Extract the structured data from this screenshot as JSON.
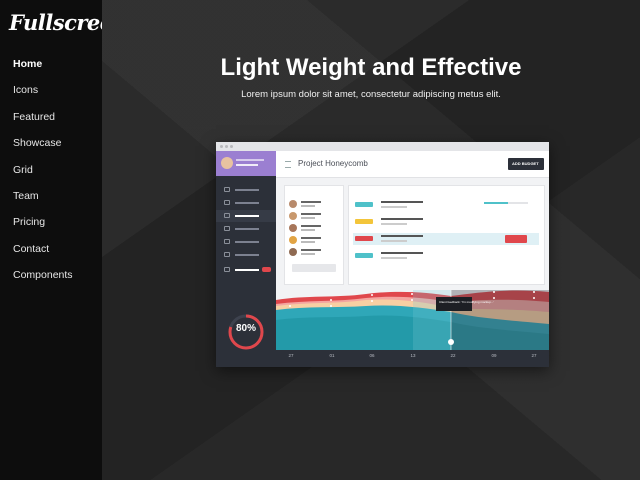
{
  "sidebar": {
    "logo": "Fullscreen",
    "items": [
      {
        "label": "Home"
      },
      {
        "label": "Icons"
      },
      {
        "label": "Featured"
      },
      {
        "label": "Showcase"
      },
      {
        "label": "Grid"
      },
      {
        "label": "Team"
      },
      {
        "label": "Pricing"
      },
      {
        "label": "Contact"
      },
      {
        "label": "Components"
      }
    ]
  },
  "hero": {
    "title": "Light Weight and Effective",
    "subtitle": "Lorem ipsum dolor sit amet, consectetur adipiscing metus elit."
  },
  "mockup": {
    "project_title": "Project Honeycomb",
    "add_button": "ADD BUDGET",
    "progress_percent": "80%",
    "axis_labels": [
      "27",
      "01",
      "06",
      "13",
      "22",
      "09",
      "27"
    ],
    "tooltip": "Client feedback: 'I'm modifying mockup...'",
    "colors": {
      "purple": "#9b7fd1",
      "red": "#e0474c",
      "teal": "#4fc1c9",
      "dark": "#2c3039"
    }
  }
}
